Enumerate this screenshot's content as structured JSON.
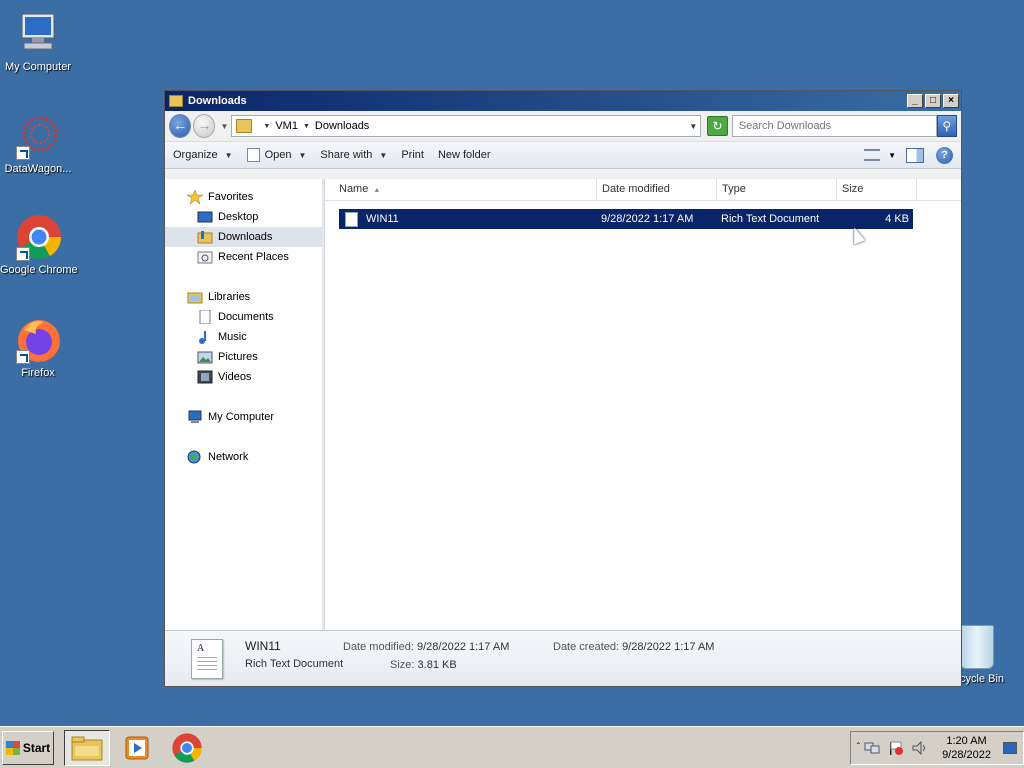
{
  "desktop": {
    "icons": [
      {
        "label": "My Computer"
      },
      {
        "label": "DataWagon..."
      },
      {
        "label": "Google Chrome"
      },
      {
        "label": "Firefox"
      }
    ],
    "recycle_bin_label": "cycle Bin"
  },
  "window": {
    "title": "Downloads",
    "address": {
      "crumbs": [
        "VM1",
        "Downloads"
      ]
    },
    "search": {
      "placeholder": "Search Downloads"
    },
    "toolbar": {
      "organize": "Organize",
      "open": "Open",
      "share_with": "Share with",
      "print": "Print",
      "new_folder": "New folder"
    },
    "navpane": {
      "favorites": "Favorites",
      "desktop": "Desktop",
      "downloads": "Downloads",
      "recent_places": "Recent Places",
      "libraries": "Libraries",
      "documents": "Documents",
      "music": "Music",
      "pictures": "Pictures",
      "videos": "Videos",
      "my_computer": "My Computer",
      "network": "Network"
    },
    "columns": {
      "name": "Name",
      "date_modified": "Date modified",
      "type": "Type",
      "size": "Size"
    },
    "files": [
      {
        "name": "WIN11",
        "date_modified": "9/28/2022 1:17 AM",
        "type": "Rich Text Document",
        "size": "4 KB"
      }
    ],
    "details": {
      "name": "WIN11",
      "type": "Rich Text Document",
      "date_modified_label": "Date modified:",
      "date_modified": "9/28/2022 1:17 AM",
      "date_created_label": "Date created:",
      "date_created": "9/28/2022 1:17 AM",
      "size_label": "Size:",
      "size": "3.81 KB"
    }
  },
  "taskbar": {
    "start_label": "Start",
    "clock_time": "1:20 AM",
    "clock_date": "9/28/2022"
  },
  "colors": {
    "desktop": "#3a6ea5",
    "selection": "#0a246a",
    "taskbar": "#d4d0c8"
  }
}
